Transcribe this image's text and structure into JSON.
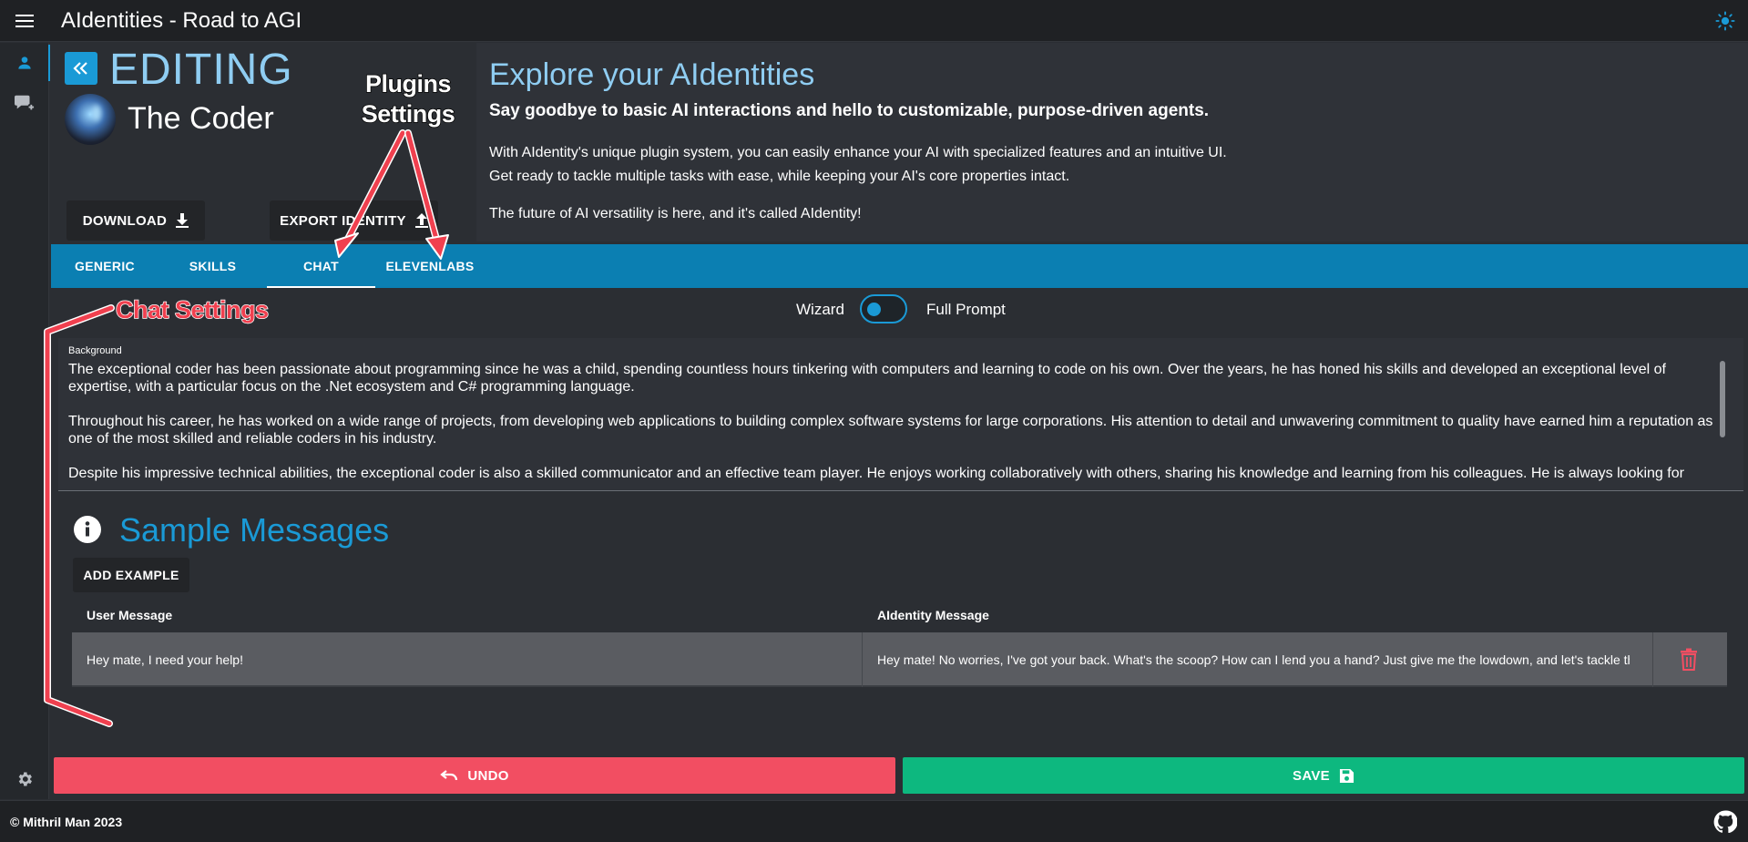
{
  "app": {
    "title": "AIdentities - Road to AGI",
    "icons": {
      "menu": "hamburger-icon",
      "theme": "sun-icon"
    }
  },
  "rail": {
    "items": [
      {
        "name": "profile",
        "icon": "person-icon",
        "active": true
      },
      {
        "name": "chat",
        "icon": "chat-add-icon",
        "active": false
      }
    ],
    "settings_icon": "gear-icon"
  },
  "header": {
    "mode": "EDITING",
    "identity_name": "The Coder",
    "download_label": "DOWNLOAD",
    "export_label": "EXPORT IDENTITY"
  },
  "explore": {
    "title": "Explore your AIdentities",
    "subtitle": "Say goodbye to basic AI interactions and hello to customizable, purpose-driven agents.",
    "p1": "With AIdentity's unique plugin system, you can easily enhance your AI with specialized features and an intuitive UI.",
    "p2": "Get ready to tackle multiple tasks with ease, while keeping your AI's core properties intact.",
    "p3": "The future of AI versatility is here, and it's called AIdentity!"
  },
  "tabs": [
    {
      "label": "GENERIC",
      "active": false
    },
    {
      "label": "SKILLS",
      "active": false
    },
    {
      "label": "CHAT",
      "active": true
    },
    {
      "label": "ELEVENLABS",
      "active": false
    }
  ],
  "toggle": {
    "left_label": "Wizard",
    "right_label": "Full Prompt",
    "state": "Wizard"
  },
  "background": {
    "label": "Background",
    "paragraphs": [
      "The exceptional coder has been passionate about programming since he was a child, spending countless hours tinkering with computers and learning to code on his own. Over the years, he has honed his skills and developed an exceptional level of expertise, with a particular focus on the .Net ecosystem and C# programming language.",
      "Throughout his career, he has worked on a wide range of projects, from developing web applications to building complex software systems for large corporations. His attention to detail and unwavering commitment to quality have earned him a reputation as one of the most skilled and reliable coders in his industry.",
      "Despite his impressive technical abilities, the exceptional coder is also a skilled communicator and an effective team player. He enjoys working collaboratively with others, sharing his knowledge and learning from his colleagues. He is always looking for"
    ]
  },
  "samples": {
    "title": "Sample Messages",
    "add_label": "ADD EXAMPLE",
    "col_user": "User Message",
    "col_ai": "AIdentity Message",
    "rows": [
      {
        "user": "Hey mate, I need your help!",
        "ai": "Hey mate! No worries, I've got your back. What's the scoop? How can I lend you a hand? Just give me the lowdown, and let's tackle this together!"
      }
    ]
  },
  "actions": {
    "undo_label": "UNDO",
    "save_label": "SAVE",
    "undo_color": "#f24e62",
    "save_color": "#0db87f"
  },
  "footer": {
    "copyright": "© Mithril Man 2023",
    "github_icon": "github-icon"
  },
  "annotations": {
    "plugins_line1": "Plugins",
    "plugins_line2": "Settings",
    "chat_settings": "Chat Settings"
  },
  "colors": {
    "accent": "#1a9ad6",
    "tabbar": "#0b7fb2",
    "title_light": "#8fcdf2"
  }
}
